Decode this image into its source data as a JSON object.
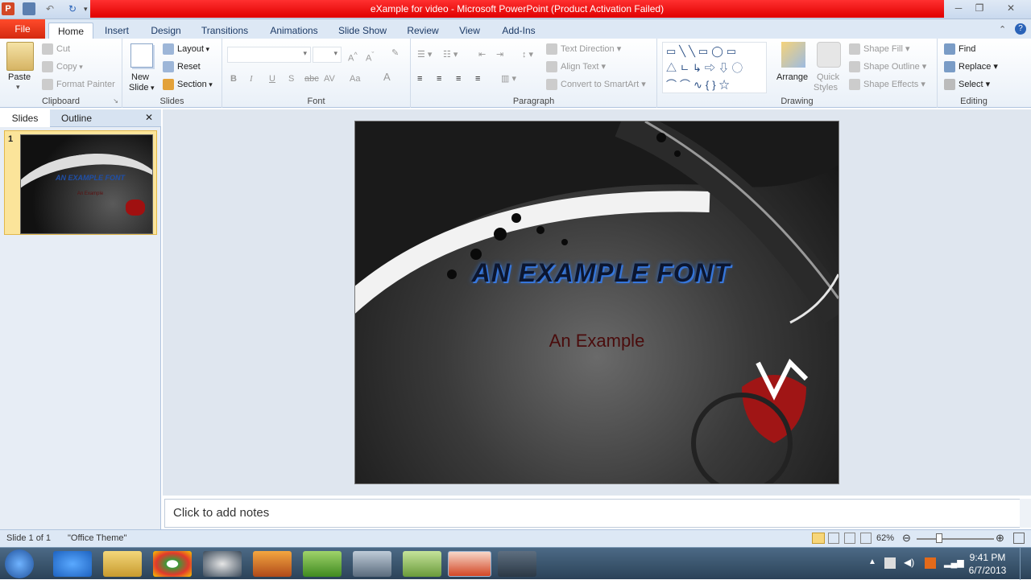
{
  "window": {
    "title": "eXample for video - Microsoft PowerPoint (Product Activation Failed)"
  },
  "tabs": [
    "File",
    "Home",
    "Insert",
    "Design",
    "Transitions",
    "Animations",
    "Slide Show",
    "Review",
    "View",
    "Add-Ins"
  ],
  "clipboard": {
    "paste": "Paste",
    "cut": "Cut",
    "copy": "Copy",
    "format_painter": "Format Painter",
    "label": "Clipboard"
  },
  "slides_group": {
    "new_slide_1": "New",
    "new_slide_2": "Slide",
    "layout": "Layout",
    "reset": "Reset",
    "section": "Section",
    "label": "Slides"
  },
  "font_group": {
    "label": "Font",
    "bold": "B",
    "italic": "I",
    "underline": "U",
    "strike": "S",
    "abc": "abc",
    "av": "AV",
    "aa": "Aa",
    "a": "A"
  },
  "paragraph": {
    "label": "Paragraph",
    "text_direction": "Text Direction",
    "align_text": "Align Text",
    "convert": "Convert to SmartArt"
  },
  "drawing": {
    "label": "Drawing",
    "arrange": "Arrange",
    "quick_1": "Quick",
    "quick_2": "Styles",
    "shape_fill": "Shape Fill",
    "shape_outline": "Shape Outline",
    "shape_effects": "Shape Effects"
  },
  "editing": {
    "label": "Editing",
    "find": "Find",
    "replace": "Replace",
    "select": "Select"
  },
  "pane": {
    "slides_tab": "Slides",
    "outline_tab": "Outline",
    "slide_number": "1",
    "close": "✕"
  },
  "slide": {
    "title": "AN EXAMPLE FONT",
    "subtitle": "An Example"
  },
  "notes": {
    "placeholder": "Click to add notes"
  },
  "status": {
    "slide_info": "Slide 1 of 1",
    "theme": "\"Office Theme\"",
    "zoom": "62%"
  },
  "taskbar": {
    "time": "9:41 PM",
    "date": "6/7/2013"
  },
  "colors": {
    "accent_red": "#e00000",
    "ribbon_blue": "#dde8f5",
    "title_blue": "#1f4fa8"
  }
}
